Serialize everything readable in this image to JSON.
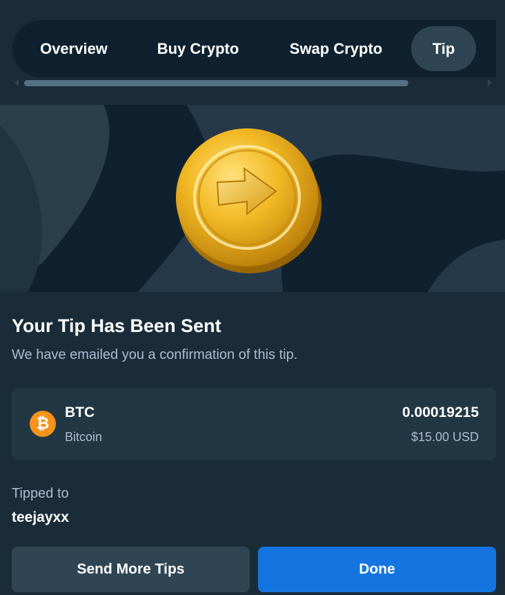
{
  "tabs": [
    {
      "label": "Overview"
    },
    {
      "label": "Buy Crypto"
    },
    {
      "label": "Swap Crypto"
    },
    {
      "label": "Tip",
      "active": true
    }
  ],
  "hero": {
    "icon": "gold-coin-arrow-icon"
  },
  "confirmation": {
    "title": "Your Tip Has Been Sent",
    "subtitle": "We have emailed you a confirmation of this tip."
  },
  "transaction": {
    "icon": "bitcoin-icon",
    "code": "BTC",
    "name": "Bitcoin",
    "amount": "0.00019215",
    "fiat": "$15.00 USD"
  },
  "recipient": {
    "label": "Tipped to",
    "username": "teejayxx"
  },
  "actions": {
    "send_more_label": "Send More Tips",
    "done_label": "Done"
  },
  "colors": {
    "background": "#1a2c38",
    "card": "#213743",
    "secondary_button": "#2f4553",
    "primary_button": "#1475e1",
    "bitcoin": "#f7931a",
    "muted_text": "#b1bad3"
  }
}
